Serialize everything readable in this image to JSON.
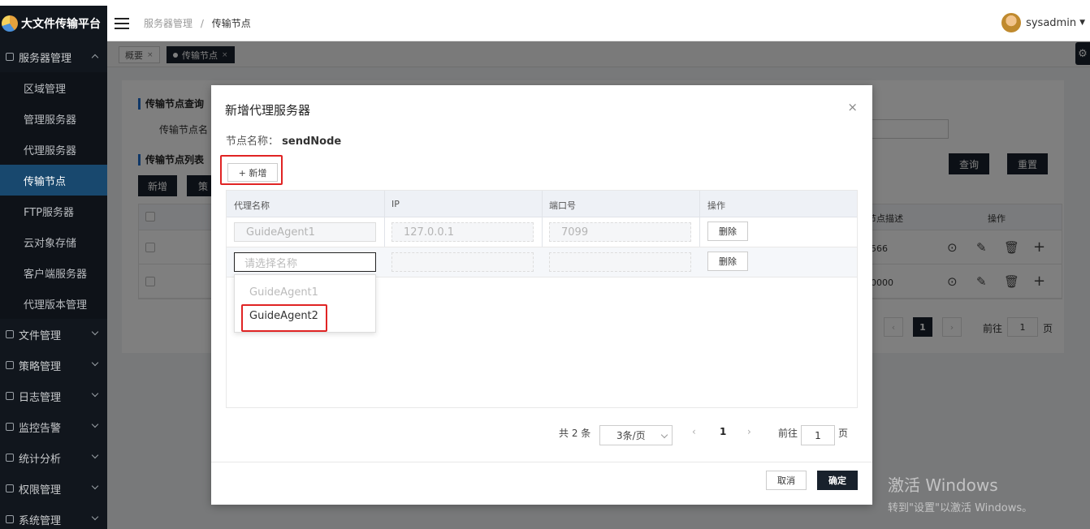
{
  "app": {
    "title": "大文件传输平台"
  },
  "header": {
    "breadcrumb_parent": "服务器管理",
    "breadcrumb_sep": "/",
    "breadcrumb_current": "传输节点",
    "username": "sysadmin"
  },
  "tabs": [
    {
      "label": "概要"
    },
    {
      "label": "传输节点"
    }
  ],
  "sidebar": {
    "groups": [
      {
        "label": "服务器管理",
        "icon": "cube-icon",
        "expanded": true
      },
      {
        "label": "文件管理",
        "icon": "folder-icon"
      },
      {
        "label": "策略管理",
        "icon": "policy-icon"
      },
      {
        "label": "日志管理",
        "icon": "log-icon"
      },
      {
        "label": "监控告警",
        "icon": "monitor-icon"
      },
      {
        "label": "统计分析",
        "icon": "stats-icon"
      },
      {
        "label": "权限管理",
        "icon": "permission-icon"
      },
      {
        "label": "系统管理",
        "icon": "settings-icon"
      }
    ],
    "items": [
      {
        "label": "区域管理"
      },
      {
        "label": "管理服务器"
      },
      {
        "label": "代理服务器"
      },
      {
        "label": "传输节点",
        "active": true
      },
      {
        "label": "FTP服务器"
      },
      {
        "label": "云对象存储"
      },
      {
        "label": "客户端服务器"
      },
      {
        "label": "代理版本管理"
      }
    ]
  },
  "background": {
    "query_title": "传输节点查询",
    "query_field_label": "传输节点名",
    "list_title": "传输节点列表",
    "btn_add": "新增",
    "btn_more": "策",
    "btn_search": "查询",
    "btn_reset": "重置",
    "col_desc": "节点描述",
    "col_ops": "操作",
    "rows": [
      {
        "desc": "566"
      },
      {
        "desc": "0000"
      }
    ],
    "pager_page": "1",
    "pager_goto": "前往",
    "pager_goto_value": "1",
    "pager_unit": "页"
  },
  "dialog": {
    "title": "新增代理服务器",
    "node_label": "节点名称：",
    "node_value": "sendNode",
    "add_button": "+ 新增",
    "columns": [
      "代理名称",
      "IP",
      "端口号",
      "操作"
    ],
    "rows": [
      {
        "name": "GuideAgent1",
        "ip": "127.0.0.1",
        "port": "7099",
        "action": "删除"
      },
      {
        "name": "",
        "name_placeholder": "请选择名称",
        "ip": "",
        "port": "",
        "action": "删除"
      }
    ],
    "dropdown_options": [
      {
        "label": "GuideAgent1",
        "disabled": true
      },
      {
        "label": "GuideAgent2",
        "disabled": false
      }
    ],
    "pagination": {
      "total": "共 2 条",
      "page_size": "3条/页",
      "current": "1",
      "goto_label": "前往",
      "goto_value": "1",
      "unit": "页"
    },
    "cancel": "取消",
    "confirm": "确定"
  },
  "watermark": {
    "line1": "激活 Windows",
    "line2": "转到\"设置\"以激活 Windows。"
  },
  "colors": {
    "sidebar_bg": "#11161d",
    "active_item": "#18486e",
    "primary_btn": "#18212c",
    "highlight": "#e02424"
  }
}
